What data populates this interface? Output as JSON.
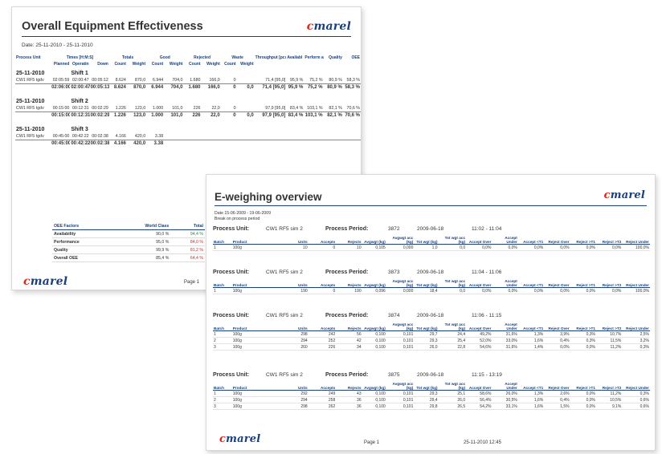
{
  "oee": {
    "title": "Overall Equipment Effectiveness",
    "logo_first": "c",
    "logo_rest": "marel",
    "date": "Date: 25-11-2010 - 25-11-2010",
    "headers": {
      "group": [
        "Process Unit",
        "Times [H:M:S]",
        "Totals",
        "Good",
        "Rejected",
        "Waste",
        "Throughput [pcs/min]",
        "Availabl e",
        "Perform ance",
        "Quality",
        "OEE"
      ],
      "sub": [
        "Planned",
        "Operatin",
        "Down",
        "Count",
        "Weight",
        "Count",
        "Weight",
        "Count",
        "Weight",
        "Count",
        "Weight"
      ]
    },
    "days": [
      {
        "date": "25-11-2010",
        "shift": "Shift 1",
        "rows": [
          [
            "CW1 RF5 tgdv",
            "02:05:59",
            "02:00:47",
            "00:05:12",
            "8.624",
            "870,0",
            "6.944",
            "704,0",
            "1.680",
            "166,0",
            "0",
            "",
            "71,4 [95,0]",
            "95,9 %",
            "75,2 %",
            "80,9 %",
            "58,3 %"
          ]
        ],
        "total": [
          "",
          "02:06:00",
          "02:00:47",
          "00:05:13",
          "8.624",
          "870,0",
          "6.944",
          "704,0",
          "1.680",
          "166,0",
          "0",
          "0,0",
          "71,4 [95,0]",
          "95,9 %",
          "75,2 %",
          "80,9 %",
          "58,3 %"
        ]
      },
      {
        "date": "25-11-2010",
        "shift": "Shift 2",
        "rows": [
          [
            "CW1 RF5 tgdv",
            "00:15:00",
            "00:12:31",
            "00:02:29",
            "1.226",
            "123,0",
            "1.000",
            "101,0",
            "226",
            "22,0",
            "0",
            "",
            "97,9 [95,0]",
            "83,4 %",
            "103,1 %",
            "82,1 %",
            "70,6 %"
          ]
        ],
        "total": [
          "",
          "00:15:00",
          "00:12:31",
          "00:02:29",
          "1.226",
          "123,0",
          "1.000",
          "101,0",
          "226",
          "22,0",
          "0",
          "0,0",
          "97,9 [95,0]",
          "83,4 %",
          "103,1 %",
          "82,1 %",
          "70,6 %"
        ]
      },
      {
        "date": "25-11-2010",
        "shift": "Shift 3",
        "rows": [
          [
            "CW1 RF5 tgdv",
            "00:45:00",
            "00:42:22",
            "00:02:38",
            "4.166",
            "420,0",
            "3.38",
            "",
            "",
            "",
            "",
            "",
            "",
            "",
            "",
            "",
            ""
          ]
        ],
        "total": [
          "",
          "00:45:00",
          "00:42:22",
          "00:02:38",
          "4.166",
          "420,0",
          "3.38",
          "",
          "",
          "",
          "",
          "",
          "",
          "",
          "",
          "",
          ""
        ]
      }
    ],
    "factors": {
      "headers": [
        "OEE Factors",
        "World Class",
        "Total"
      ],
      "rows": [
        [
          "Availability",
          "90,0 %",
          "94,4 %"
        ],
        [
          "Performance",
          "95,0 %",
          "84,0 %"
        ],
        [
          "Quality",
          "99,9 %",
          "81,2 %"
        ],
        [
          "Overall OEE",
          "85,4 %",
          "64,4 %"
        ]
      ],
      "total_colors": [
        "green",
        "red",
        "red",
        "red"
      ]
    },
    "page": "Page 1"
  },
  "ew": {
    "title": "E-weighing overview",
    "date_line": "Date 15-06-2009 - 19-06-2009",
    "break_line": "Break on process period",
    "labels": {
      "process_unit": "Process Unit:",
      "process_period": "Process Period:"
    },
    "headers": [
      "Batch",
      "Product",
      "Units",
      "Accepts",
      "Rejects",
      "Avgwgt (kg)",
      "Avgwgt acc (kg)",
      "Tot wgt (kg)",
      "Tot wgt acc (kg)",
      "Accept Over",
      "Accept Under",
      "Accept <T1",
      "Reject Over",
      "Reject >T1",
      "Reject >T2",
      "Reject Under"
    ],
    "blocks": [
      {
        "unit": "CW1 RF5 sim 2",
        "period": "3872",
        "date": "2009-06-18",
        "time": "11:02  -  11:04",
        "rows": [
          [
            "1",
            "100g",
            "10",
            "0",
            "10",
            "0,105",
            "0,000",
            "1,0",
            "0,0",
            "0,0%",
            "0,0%",
            "0,0%",
            "0,0%",
            "0,0%",
            "0,0%",
            "100,0%"
          ]
        ]
      },
      {
        "unit": "CW1 RF5 sim 2",
        "period": "3873",
        "date": "2009-06-18",
        "time": "11:04  -  11:06",
        "rows": [
          [
            "1",
            "100g",
            "190",
            "0",
            "190",
            "0,096",
            "0,000",
            "18,4",
            "0,0",
            "0,0%",
            "0,0%",
            "0,0%",
            "0,0%",
            "0,0%",
            "0,0%",
            "100,0%"
          ]
        ]
      },
      {
        "unit": "CW1 RF5 sim 2",
        "period": "3874",
        "date": "2009-06-18",
        "time": "11:06  -  11:15",
        "rows": [
          [
            "1",
            "100g",
            "298",
            "242",
            "56",
            "0,100",
            "0,101",
            "29,7",
            "24,4",
            "49,2%",
            "31,6%",
            "1,3%",
            "3,9%",
            "0,3%",
            "10,7%",
            "2,5%"
          ],
          [
            "2",
            "100g",
            "294",
            "252",
            "42",
            "0,100",
            "0,101",
            "29,3",
            "25,4",
            "52,0%",
            "33,0%",
            "1,6%",
            "0,4%",
            "0,3%",
            "11,5%",
            "3,2%"
          ],
          [
            "3",
            "100g",
            "260",
            "226",
            "34",
            "0,100",
            "0,101",
            "26,0",
            "22,8",
            "54,6%",
            "31,6%",
            "1,4%",
            "0,0%",
            "0,0%",
            "11,2%",
            "0,3%"
          ]
        ]
      },
      {
        "unit": "CW1 RF5 sim 2",
        "period": "3875",
        "date": "2009-06-18",
        "time": "11:15  -  13:19",
        "rows": [
          [
            "1",
            "100g",
            "292",
            "249",
            "43",
            "0,100",
            "0,101",
            "29,3",
            "25,1",
            "58,6%",
            "26,0%",
            "1,3%",
            "2,6%",
            "0,0%",
            "11,2%",
            "0,3%"
          ],
          [
            "2",
            "100g",
            "294",
            "258",
            "36",
            "0,100",
            "0,101",
            "29,4",
            "26,0",
            "56,4%",
            "30,5%",
            "1,6%",
            "0,4%",
            "0,0%",
            "10,5%",
            "0,6%"
          ],
          [
            "3",
            "100g",
            "298",
            "262",
            "36",
            "0,100",
            "0,101",
            "29,8",
            "26,5",
            "54,2%",
            "33,1%",
            "1,6%",
            "1,5%",
            "0,0%",
            "9,1%",
            "0,6%"
          ]
        ]
      }
    ],
    "page": "Page 1",
    "stamp": "25-11-2010 12:45"
  }
}
